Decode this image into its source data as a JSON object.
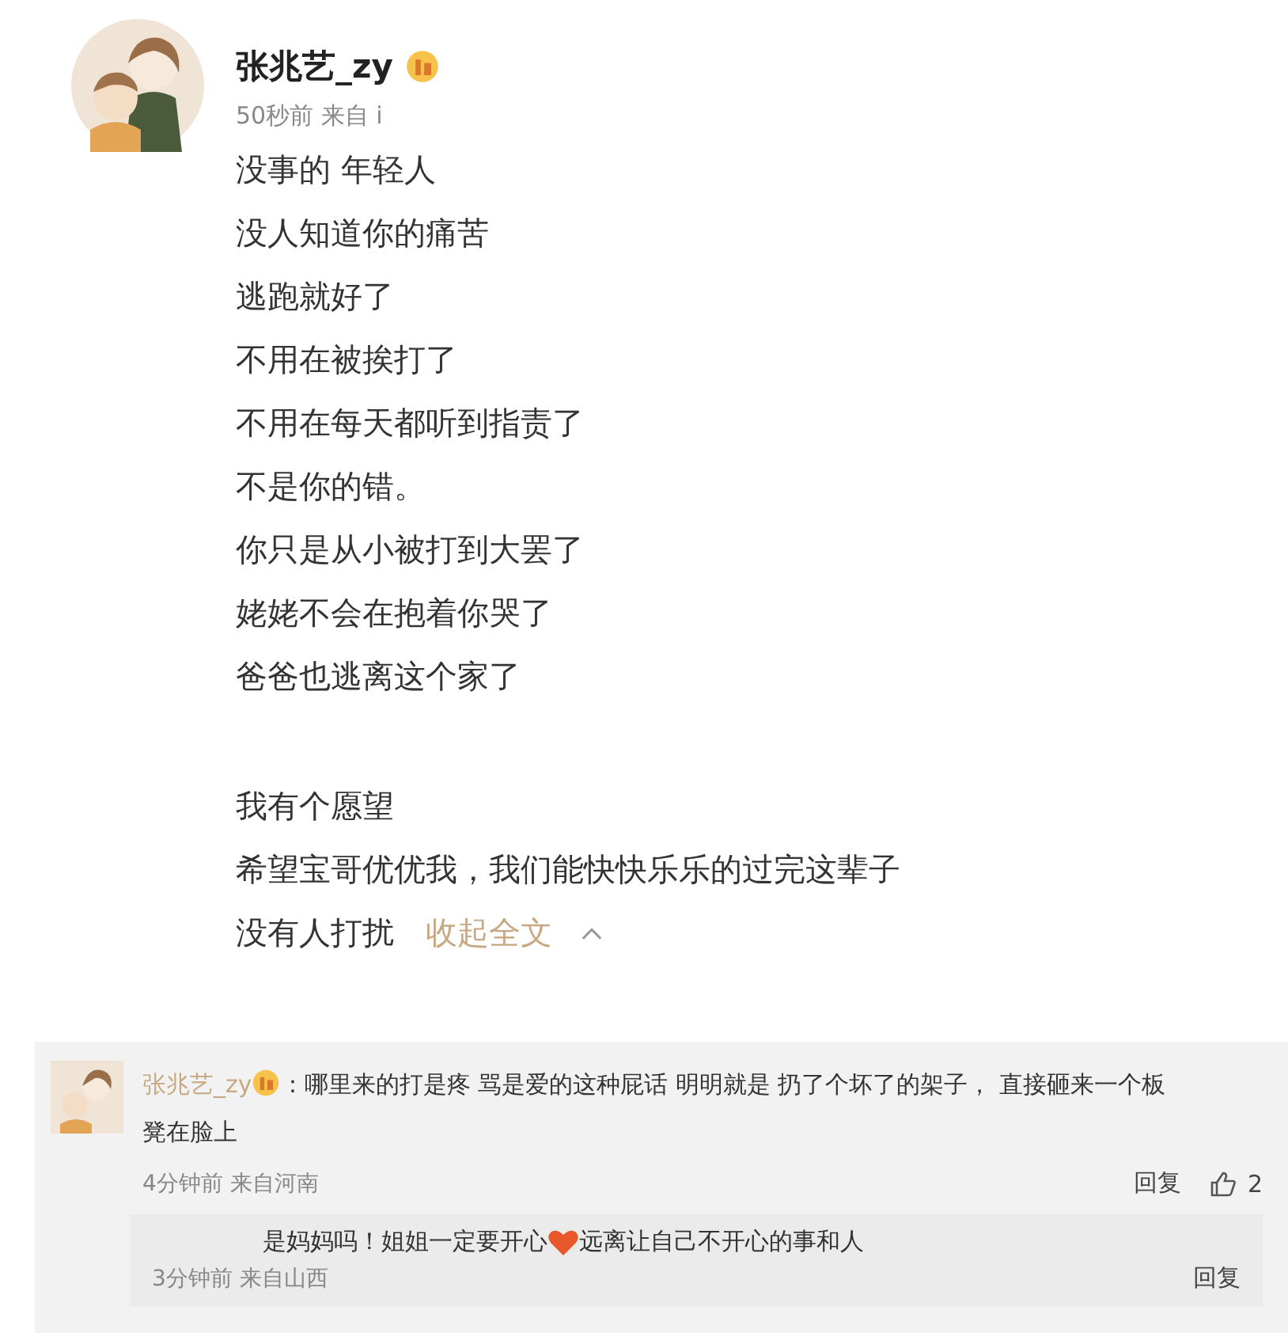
{
  "post": {
    "author": "张兆艺_zy",
    "time": "50秒前",
    "source": "来自 i",
    "paragraphs": [
      [
        "没事的 年轻人",
        "没人知道你的痛苦",
        "逃跑就好了",
        "不用在被挨打了",
        "不用在每天都听到指责了",
        "不是你的错。",
        "你只是从小被打到大罢了",
        "姥姥不会在抱着你哭了",
        "爸爸也逃离这个家了"
      ],
      [
        "我有个愿望",
        "希望宝哥优优我，我们能快快乐乐的过完这辈子",
        "没有人打扰"
      ]
    ],
    "collapse_link": "收起全文"
  },
  "comments": [
    {
      "author": "张兆艺_zy",
      "colon": "：",
      "text_lines": [
        "哪里来的打是疼 骂是爱的这种屁话 明明就是 扔了个坏了的架子， 直接砸来一个板",
        "凳在脸上"
      ],
      "time": "4分钟前",
      "location": "来自河南",
      "reply_label": "回复",
      "like_count": "2",
      "replies": [
        {
          "text_before": "是妈妈吗！姐姐一定要开心",
          "text_after": "远离让自己不开心的事和人",
          "time": "3分钟前",
          "location": "来自山西",
          "reply_label": "回复"
        }
      ]
    }
  ]
}
